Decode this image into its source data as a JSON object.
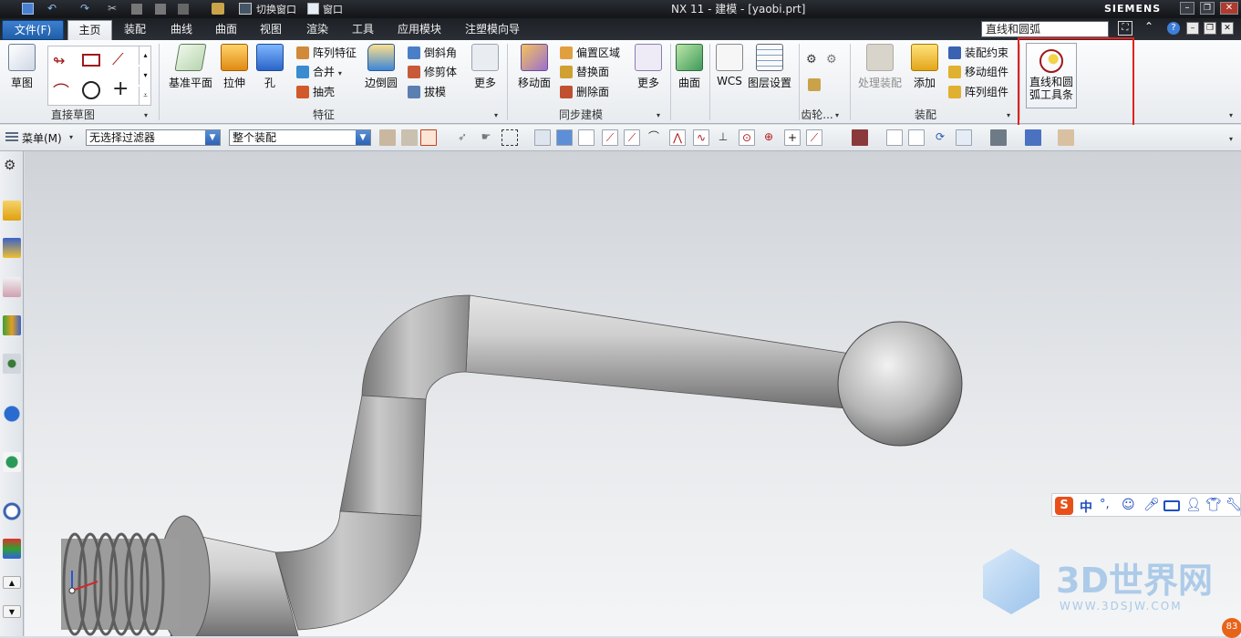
{
  "window": {
    "title": "NX 11 - 建模 - [yaobi.prt]",
    "brand": "SIEMENS",
    "quick_access": {
      "switch_window": "切换窗口",
      "window_menu": "窗口"
    }
  },
  "tabs": {
    "file": "文件(F)",
    "items": [
      "主页",
      "装配",
      "曲线",
      "曲面",
      "视图",
      "渲染",
      "工具",
      "应用模块",
      "注塑模向导"
    ],
    "active": "主页"
  },
  "search": {
    "value": "直线和圆弧"
  },
  "ribbon": {
    "sketch": {
      "label": "草图",
      "group": "直接草图"
    },
    "feature": {
      "group": "特征",
      "datum_plane": "基准平面",
      "extrude": "拉伸",
      "hole": "孔",
      "pattern_feature": "阵列特征",
      "unite": "合并",
      "shell": "抽壳",
      "edge_blend": "边倒圆",
      "chamfer": "倒斜角",
      "trim_body": "修剪体",
      "draft": "拔模",
      "more": "更多"
    },
    "sync": {
      "group": "同步建模",
      "move_face": "移动面",
      "offset_region": "偏置区域",
      "replace_face": "替换面",
      "delete_face": "删除面",
      "more": "更多"
    },
    "surface": {
      "label": "曲面"
    },
    "wcs": {
      "label": "WCS",
      "layer_settings": "图层设置"
    },
    "gear": {
      "group": "齿轮..."
    },
    "assembly": {
      "group": "装配",
      "process_assembly": "处理装配",
      "add": "添加",
      "constraint": "装配约束",
      "move_component": "移动组件",
      "pattern_component": "阵列组件"
    },
    "line_arc_toolbar": {
      "label_line1": "直线和圆",
      "label_line2": "弧工具条"
    }
  },
  "toolbar2": {
    "menu": "菜单(M)",
    "filter": "无选择过滤器",
    "scope": "整个装配"
  },
  "ime": {
    "lang": "中"
  },
  "watermark": {
    "text": "3D世界网",
    "url_text": "WWW.3DSJW.COM"
  },
  "badge": {
    "value": "83"
  },
  "colors": {
    "highlight_box": "#e0211e",
    "file_tab": "#2a6bbf",
    "model_gray": "#a9a9a9"
  }
}
